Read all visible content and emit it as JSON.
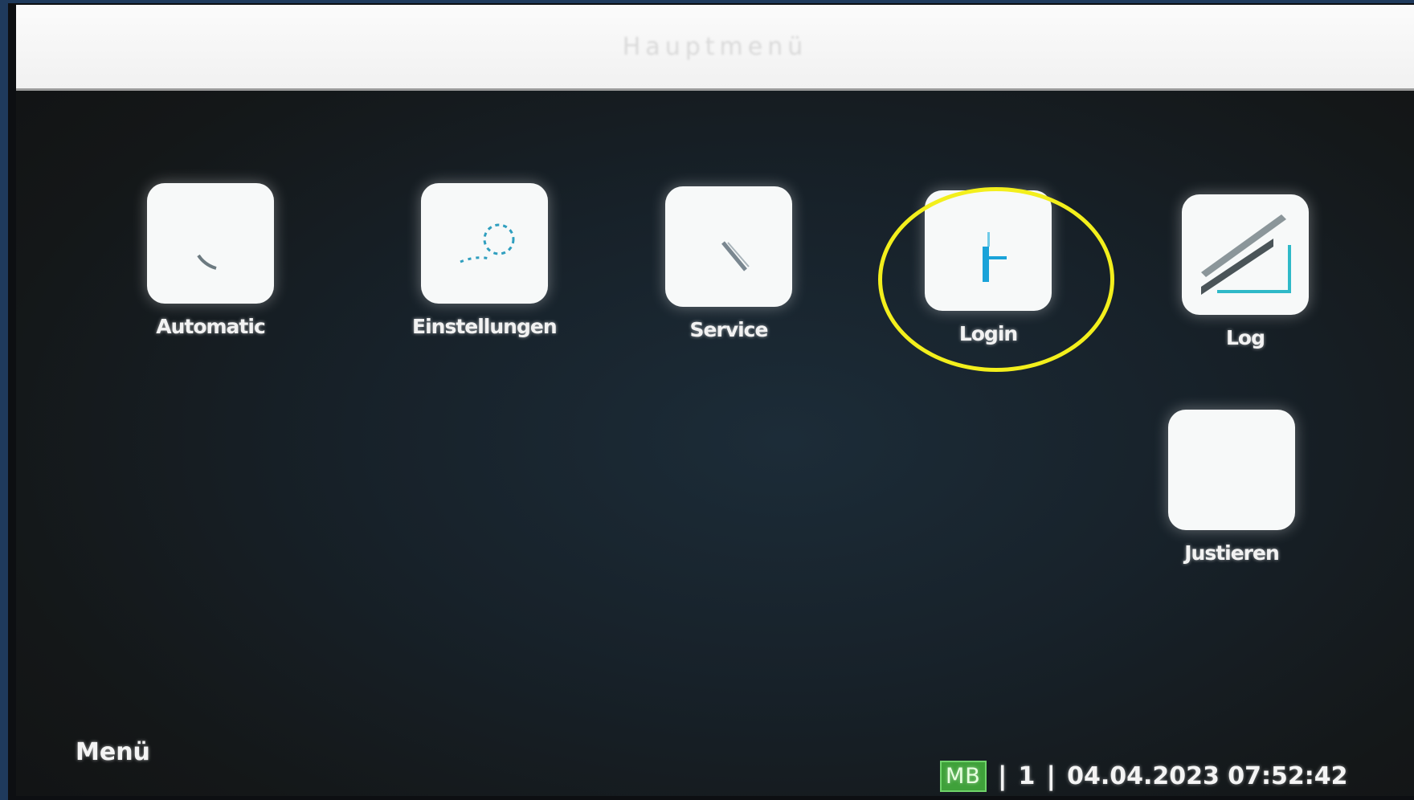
{
  "window": {
    "title": "Hauptmenü"
  },
  "tiles": [
    {
      "label": "Automatic",
      "icon": "gauge-icon"
    },
    {
      "label": "Einstellungen",
      "icon": "gears-icon"
    },
    {
      "label": "Service",
      "icon": "screwdriver-icon"
    },
    {
      "label": "Login",
      "icon": "key-icon"
    },
    {
      "label": "Log",
      "icon": "logbook-icon"
    },
    {
      "label": "Justieren",
      "icon": "calibrate-icon"
    }
  ],
  "footer": {
    "menu_label": "Menü",
    "mode_badge": "MB",
    "separator": "|",
    "user_level": "1",
    "datetime": "04.04.2023 07:52:42"
  },
  "colors": {
    "highlight_ring": "#f3ef1c",
    "mode_badge_bg": "#3fa13a",
    "icon_accent": "#1aa3d9"
  }
}
